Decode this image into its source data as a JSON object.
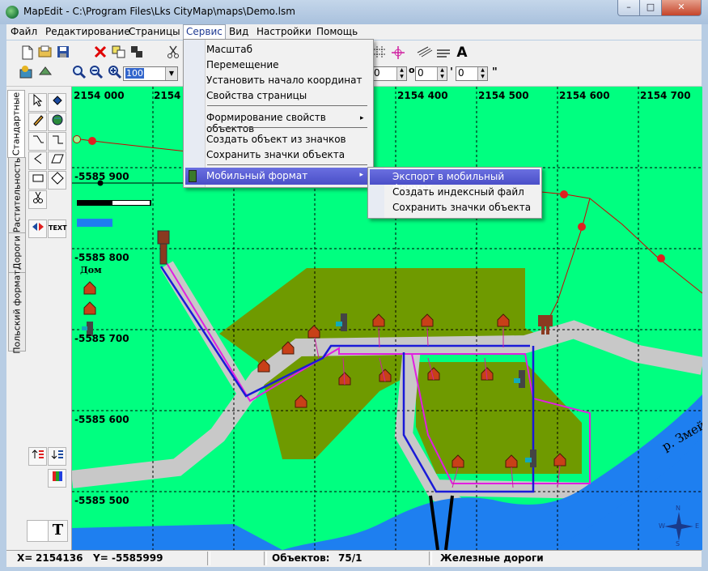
{
  "window": {
    "title": "MapEdit - C:\\Program Files\\Lks CityMap\\maps\\Demo.lsm",
    "min_glyph": "–",
    "max_glyph": "□",
    "close_glyph": "✕"
  },
  "menu": [
    "Файл",
    "Редактирование",
    "Страницы",
    "Сервис",
    "Вид",
    "Настройки",
    "Помощь"
  ],
  "toolbar": {
    "zoom_value": "100",
    "zoom_arrow": "▼",
    "spin1": "0",
    "spin2": "0",
    "spin3": "0",
    "spin4": "0",
    "deg_mark": "o",
    "min_mark": "'",
    "sec_mark": "\"",
    "text_tool": "A",
    "icons": [
      "new-file-icon",
      "open-file-icon",
      "save-icon",
      "delete-icon",
      "copy-icon",
      "paste-icon",
      "cut-icon",
      "zoom-out-icon",
      "zoom-in-icon",
      "zoom-fit-icon",
      "grid-icon",
      "crosshair-icon",
      "layers-icon",
      "hatch-icon",
      "text-icon"
    ]
  },
  "left_tabs": [
    "Стандартные",
    "Растительность",
    "Дороги",
    "Польский формат"
  ],
  "palette": {
    "text_button": "TEXT",
    "big_t": "T"
  },
  "service_menu": {
    "items": [
      "Масштаб",
      "Перемещение",
      "Установить начало координат",
      "Свойства страницы",
      "Формирование свойств объектов",
      "Создать объект из значков",
      "Сохранить значки объекта",
      "Мобильный формат"
    ],
    "submenu_arrow": "▸"
  },
  "mobile_submenu": {
    "items": [
      "Экспорт в мобильный формат",
      "Создать индексный файл",
      "Сохранить значки объекта"
    ]
  },
  "map": {
    "x_labels": [
      "2154 000",
      "2154",
      "2154 400",
      "2154 500",
      "2154 600",
      "2154 700"
    ],
    "y_labels": [
      "-5585 900",
      "-5585 800",
      "-5585 700",
      "-5585 600",
      "-5585 500"
    ],
    "legend_label": "Дом",
    "river_label": "р. Змей",
    "compass": {
      "n": "N",
      "s": "S",
      "w": "W",
      "e": "E"
    },
    "colors": {
      "background": "#00ff80",
      "forest": "#6f9a00",
      "road": "#c8c8c8",
      "river": "#1e7ff0",
      "pipe_blue": "#1a1ad8",
      "pipe_magenta": "#e020e0",
      "rail": "#d00000"
    }
  },
  "status": {
    "x_label": "X=",
    "x_value": "2154136",
    "y_label": "Y=",
    "y_value": "-5585999",
    "objects_label": "Объектов:",
    "objects_value": "75/1",
    "layer": "Железные дороги"
  }
}
